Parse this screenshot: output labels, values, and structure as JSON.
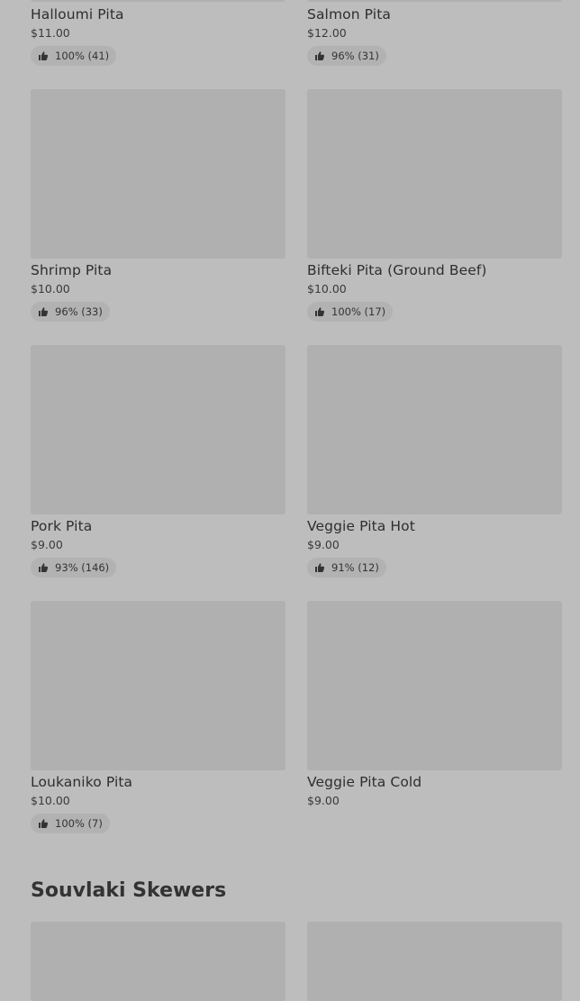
{
  "menu": {
    "items": [
      {
        "name": "Halloumi Pita",
        "price": "$11.00",
        "rating": "100% (41)"
      },
      {
        "name": "Salmon Pita",
        "price": "$12.00",
        "rating": "96% (31)"
      },
      {
        "name": "Shrimp Pita",
        "price": "$10.00",
        "rating": "96% (33)"
      },
      {
        "name": "Bifteki Pita (Ground Beef)",
        "price": "$10.00",
        "rating": "100% (17)"
      },
      {
        "name": "Pork Pita",
        "price": "$9.00",
        "rating": "93% (146)"
      },
      {
        "name": "Veggie Pita Hot",
        "price": "$9.00",
        "rating": "91% (12)"
      },
      {
        "name": "Loukaniko Pita",
        "price": "$10.00",
        "rating": "100% (7)"
      },
      {
        "name": "Veggie Pita Cold",
        "price": "$9.00"
      }
    ]
  },
  "sections": {
    "souvlaki_title": "Souvlaki Skewers"
  },
  "icons": {
    "rating": "thumbs-up-icon"
  },
  "colors": {
    "page_bg": "#bdbdbd",
    "image_placeholder": "#b0b0b0",
    "rating_pill": "#b2b2b2"
  }
}
